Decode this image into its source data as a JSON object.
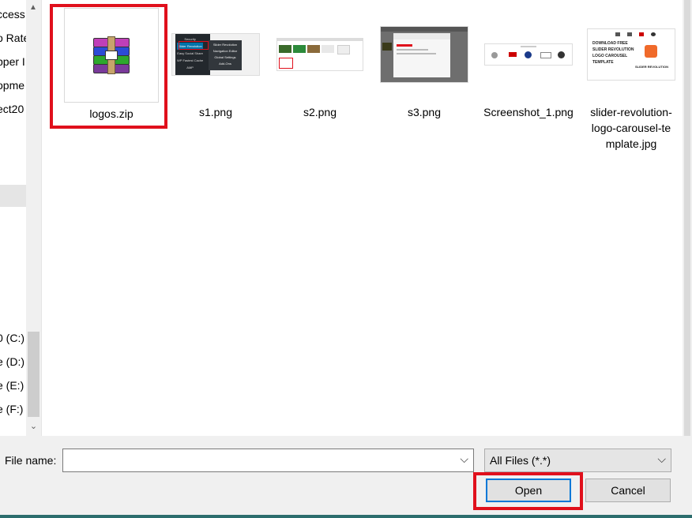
{
  "nav": {
    "items_top": [
      "ccess s",
      "o Rate",
      "pper I",
      "opme",
      "ect20"
    ],
    "drives": [
      "0 (C:)",
      "e (D:)",
      "e (E:)",
      "e (F:)"
    ]
  },
  "files": [
    {
      "name": "logos.zip",
      "icon": "winrar-archive-icon"
    },
    {
      "name": "s1.png"
    },
    {
      "name": "s2.png"
    },
    {
      "name": "s3.png"
    },
    {
      "name": "Screenshot_1.png"
    },
    {
      "name_lines": [
        "slider-revolution-",
        "logo-carousel-te",
        "mplate.jpg"
      ]
    }
  ],
  "thumb_text": {
    "s1_menu": [
      "Security",
      "Slider Revolution",
      "Easy Social Share",
      "WP Fastest Cache",
      "AMP"
    ],
    "s1_sub": [
      "Slider Revolution",
      "Navigation Editor",
      "Global Settings",
      "Add-Ons"
    ],
    "slider_text": [
      "DOWNLOAD FREE",
      "SLIDER REVOLUTION",
      "LOGO CAROUSEL",
      "TEMPLATE"
    ],
    "slider_brand": "SLIDER REVOLUTION"
  },
  "footer": {
    "file_name_label": "File name:",
    "file_name_value": "",
    "filter_value": "All Files (*.*)",
    "open_label": "Open",
    "cancel_label": "Cancel"
  },
  "colors": {
    "highlight": "#e0101c",
    "open_focus": "#0078d7",
    "selected_nav": "#e5e5e5"
  }
}
